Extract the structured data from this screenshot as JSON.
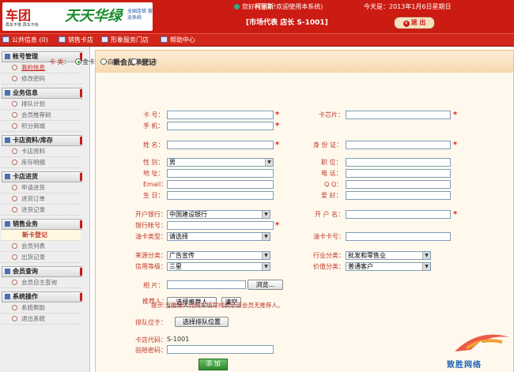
{
  "header": {
    "logo": {
      "brand": "车团",
      "tagline": "再车不慢 再车不快",
      "slogan": "天天华绿",
      "subtitle": "全国连锁 营运系统"
    },
    "welcome_prefix": "您好",
    "user": "柯丽斯",
    "welcome_suffix": "!欢迎使用本系统)",
    "today": "今天是：2013年1月6日星期日",
    "store_info": "[市场代表 店长 S-1001]",
    "logout_label": "退 出"
  },
  "menubar": {
    "items": [
      "公共信息 (0)",
      "销售卡店",
      "形象服务门店",
      "帮助中心"
    ]
  },
  "sidebar": {
    "sections": [
      {
        "title": "帐号管理",
        "items": [
          "我的信息",
          "修改密码"
        ]
      },
      {
        "title": "业务信息",
        "items": [
          "排队计划",
          "会员推荐树",
          "积分商城"
        ]
      },
      {
        "title": "卡店资料/库存",
        "items": [
          "卡店资料",
          "库存明细"
        ]
      },
      {
        "title": "卡店进货",
        "items": [
          "申请进货",
          "进货订单",
          "进货记录"
        ]
      },
      {
        "title": "销售业务",
        "items": [
          "新卡登记",
          "会员列表",
          "出货记录"
        ]
      },
      {
        "title": "会员查询",
        "items": [
          "会员自主查询"
        ]
      },
      {
        "title": "系统操作",
        "items": [
          "系统帮助",
          "退出系统"
        ]
      }
    ],
    "active_item": "我的信息",
    "current_item": "新卡登记"
  },
  "page_title": "新会员卡登记",
  "form": {
    "card_type_label": "卡 类：",
    "card_type_options": [
      "金卡",
      "白金卡",
      "钻石卡"
    ],
    "card_type_selected": "金卡",
    "card_no_label": "卡 号：",
    "card_no_value": "",
    "chip_label": "卡芯片：",
    "chip_value": "",
    "mobile_label": "手 机：",
    "mobile_value": "",
    "name_label": "姓 名：",
    "name_value": "",
    "id_label": "身 份 证：",
    "id_value": "",
    "gender_label": "性 别：",
    "gender_value": "男",
    "position_label": "职 位：",
    "address_label": "地 址：",
    "phone_label": "电 话：",
    "email_label": "Email：",
    "qq_label": "Q Q：",
    "birthday_label": "生 日：",
    "hobby_label": "爱 好：",
    "bank_label": "开户银行：",
    "bank_value": "中国建设银行",
    "account_name_label": "开 户 名：",
    "bank_account_label": "银行帐号：",
    "card_category_label": "油卡类型：",
    "card_category_value": "请选择",
    "oil_card_label": "油卡卡号：",
    "source_label": "来源分类：",
    "source_value": "广告宣传",
    "industry_label": "行业分类：",
    "industry_value": "批发和零售业",
    "credit_label": "信用等级：",
    "credit_value": "三星",
    "value_label": "价值分类：",
    "value_value": "普通客户",
    "photo_label": "相 片：",
    "browse_label": "浏览...",
    "referrer_label": "推荐人：",
    "choose_referrer_label": "选择推荐人",
    "clear_label": "清空",
    "referrer_hint": "提示:当推荐人代码未填写时表示该会员无推荐人。",
    "queue_label": "排队位于：",
    "queue_button_label": "选择排队位置",
    "shop_code_label": "卡店代码：",
    "shop_code_value": "S-1001",
    "verify_label": "验陪密码：",
    "submit_label": "添 加"
  },
  "watermark": {
    "text": "致胜网络"
  },
  "colors": {
    "header_red": "#cc1b12",
    "label_red": "#c0392b",
    "required_star": "#e02020",
    "accent_orange": "#d46b10"
  }
}
